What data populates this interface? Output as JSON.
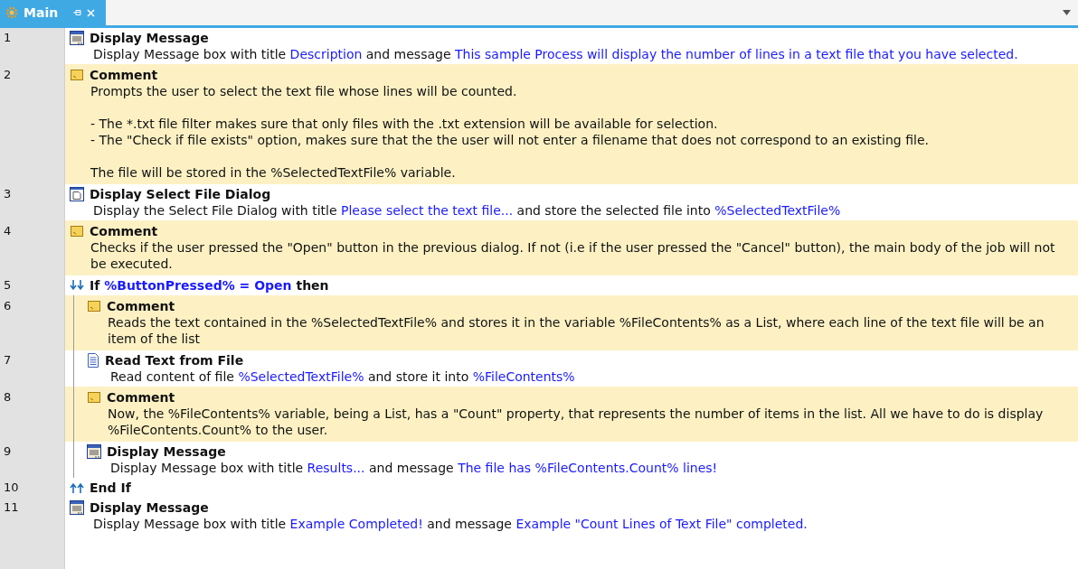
{
  "tab": {
    "title": "Main",
    "selected": true
  },
  "steps": [
    {
      "number": "1",
      "kind": "message",
      "title": [
        {
          "text": "Display Message",
          "highlighted": false
        }
      ],
      "paragraphs": [
        [
          [
            {
              "text": "Display Message box with title ",
              "highlighted": false
            },
            {
              "text": "Description",
              "highlighted": true
            },
            {
              "text": " and message ",
              "highlighted": false
            },
            {
              "text": "This sample Process will display the number of lines in a text file that you have selected.",
              "highlighted": true
            }
          ]
        ]
      ]
    },
    {
      "number": "2",
      "kind": "comment",
      "title": [
        {
          "text": "Comment",
          "highlighted": false
        }
      ],
      "paragraphs": [
        [
          [
            {
              "text": "Prompts the user to select the text file whose lines will be counted.",
              "highlighted": false
            }
          ]
        ],
        [
          [
            {
              "text": "- The *.txt file filter makes sure that only files with the .txt extension will be available for selection.",
              "highlighted": false
            }
          ],
          [
            {
              "text": "- The \"Check if file exists\" option, makes sure that the the user will not enter a filename that does not correspond to an existing file.",
              "highlighted": false
            }
          ]
        ],
        [
          [
            {
              "text": "The file will be stored in the %SelectedTextFile% variable.",
              "highlighted": false
            }
          ]
        ]
      ]
    },
    {
      "number": "3",
      "kind": "dialog",
      "title": [
        {
          "text": "Display Select File Dialog",
          "highlighted": false
        }
      ],
      "paragraphs": [
        [
          [
            {
              "text": "Display the Select File Dialog with title ",
              "highlighted": false
            },
            {
              "text": "Please select the text file...",
              "highlighted": true
            },
            {
              "text": " and store the selected file into ",
              "highlighted": false
            },
            {
              "text": "%SelectedTextFile%",
              "highlighted": true
            }
          ]
        ]
      ]
    },
    {
      "number": "4",
      "kind": "comment",
      "title": [
        {
          "text": "Comment",
          "highlighted": false
        }
      ],
      "paragraphs": [
        [
          [
            {
              "text": "Checks if the user pressed the \"Open\" button in the previous dialog. If not (i.e if the user pressed the \"Cancel\" button), the main body of the job will not be executed.",
              "highlighted": false
            }
          ]
        ]
      ]
    },
    {
      "number": "5",
      "kind": "if",
      "title": [
        {
          "text": "If ",
          "highlighted": false
        },
        {
          "text": "%ButtonPressed% = Open",
          "highlighted": true
        },
        {
          "text": " then",
          "highlighted": false
        }
      ],
      "children": [
        {
          "number": "6",
          "kind": "comment",
          "title": [
            {
              "text": "Comment",
              "highlighted": false
            }
          ],
          "paragraphs": [
            [
              [
                {
                  "text": "Reads the text contained in the %SelectedTextFile% and stores it in the variable %FileContents% as a List, where each line of the text file will be an item of the list",
                  "highlighted": false
                }
              ]
            ]
          ]
        },
        {
          "number": "7",
          "kind": "read",
          "title": [
            {
              "text": "Read Text from File",
              "highlighted": false
            }
          ],
          "paragraphs": [
            [
              [
                {
                  "text": "Read content of file ",
                  "highlighted": false
                },
                {
                  "text": "%SelectedTextFile%",
                  "highlighted": true
                },
                {
                  "text": " and store it into ",
                  "highlighted": false
                },
                {
                  "text": "%FileContents%",
                  "highlighted": true
                }
              ]
            ]
          ]
        },
        {
          "number": "8",
          "kind": "comment",
          "title": [
            {
              "text": "Comment",
              "highlighted": false
            }
          ],
          "paragraphs": [
            [
              [
                {
                  "text": "Now, the %FileContents% variable, being a List, has a \"Count\" property, that represents the number of items in the list. All we have to do is display %FileContents.Count% to the user.",
                  "highlighted": false
                }
              ]
            ]
          ]
        },
        {
          "number": "9",
          "kind": "message",
          "title": [
            {
              "text": "Display Message",
              "highlighted": false
            }
          ],
          "paragraphs": [
            [
              [
                {
                  "text": "Display Message box with title ",
                  "highlighted": false
                },
                {
                  "text": "Results...",
                  "highlighted": true
                },
                {
                  "text": " and message ",
                  "highlighted": false
                },
                {
                  "text": "The file has %FileContents.Count% lines!",
                  "highlighted": true
                }
              ]
            ]
          ]
        }
      ]
    },
    {
      "number": "10",
      "kind": "endif",
      "title": [
        {
          "text": "End If",
          "highlighted": false
        }
      ]
    },
    {
      "number": "11",
      "kind": "message",
      "title": [
        {
          "text": "Display Message",
          "highlighted": false
        }
      ],
      "paragraphs": [
        [
          [
            {
              "text": "Display Message box with title ",
              "highlighted": false
            },
            {
              "text": "Example Completed!",
              "highlighted": true
            },
            {
              "text": " and message ",
              "highlighted": false
            },
            {
              "text": "Example \"Count Lines of Text File\" completed.",
              "highlighted": true
            }
          ]
        ]
      ]
    }
  ]
}
